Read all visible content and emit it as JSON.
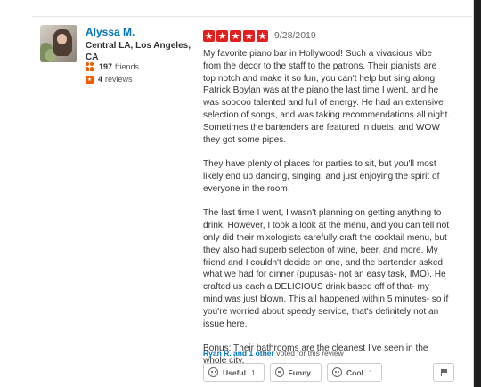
{
  "user": {
    "name": "Alyssa M.",
    "location": "Central LA, Los Angeles, CA",
    "friends_count": "197",
    "friends_label": "friends",
    "reviews_count": "4",
    "reviews_label": "reviews",
    "avatar_icon": "user-avatar"
  },
  "review": {
    "rating": 5,
    "rating_max": 5,
    "star_color": "#e21f1f",
    "date": "9/28/2019",
    "paragraphs": [
      "My favorite piano bar in Hollywood!  Such a vivacious vibe from the decor to the staff to the patrons. Their pianists are top notch and make it so fun, you can't help but sing along. Patrick Boylan was at the piano the last time I went, and he was sooooo talented and full of energy.  He had an extensive selection of songs, and was taking recommendations all night. Sometimes the bartenders are featured in duets, and WOW they got some pipes.",
      "They have plenty of places for parties to sit, but you'll most likely end up dancing, singing, and just enjoying the spirit of everyone in the room.",
      "The last time I went, I wasn't planning on getting anything to drink. However, I took a look at the menu, and you can tell not only did their mixologists carefully craft the cocktail menu, but they also had superb selection of wine, beer, and more. My friend and I couldn't decide on one, and the bartender asked what we had for dinner (pupusas- not an easy task, IMO). He crafted us each a DELICIOUS drink based off of that- my mind was just blown. This all happened within 5 minutes- so if you're worried about speedy service, that's definitely not an issue here.",
      "Bonus: Their bathrooms are the cleanest I've seen in the whole city."
    ]
  },
  "votes": {
    "voters_link": "Ryan R. and 1 other",
    "voters_text": " voted for this review",
    "buttons": [
      {
        "label": "Useful",
        "count": "1",
        "icon": "useful-icon"
      },
      {
        "label": "Funny",
        "count": "",
        "icon": "funny-icon"
      },
      {
        "label": "Cool",
        "count": "1",
        "icon": "cool-icon"
      }
    ],
    "flag_icon": "flag-icon"
  },
  "colors": {
    "link": "#0073bb",
    "accent": "#f15c00",
    "star": "#e21f1f"
  }
}
